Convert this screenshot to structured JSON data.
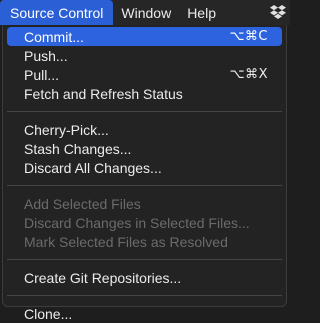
{
  "menubar": {
    "items": [
      "Source Control",
      "Window",
      "Help"
    ]
  },
  "menu": {
    "commit": {
      "label": "Commit...",
      "shortcut": "⌥⌘C"
    },
    "push": {
      "label": "Push..."
    },
    "pull": {
      "label": "Pull...",
      "shortcut": "⌥⌘X"
    },
    "fetch": {
      "label": "Fetch and Refresh Status"
    },
    "cherry_pick": {
      "label": "Cherry-Pick..."
    },
    "stash": {
      "label": "Stash Changes..."
    },
    "discard_all": {
      "label": "Discard All Changes..."
    },
    "add_selected": {
      "label": "Add Selected Files"
    },
    "discard_selected": {
      "label": "Discard Changes in Selected Files..."
    },
    "mark_resolved": {
      "label": "Mark Selected Files as Resolved"
    },
    "create_repos": {
      "label": "Create Git Repositories..."
    },
    "clone": {
      "label": "Clone..."
    }
  },
  "icons": {
    "dropbox": "dropbox-icon"
  },
  "colors": {
    "highlight": "#2d63de",
    "menubar_active": "#2a5fd6",
    "disabled_text": "#6b6b6b"
  }
}
